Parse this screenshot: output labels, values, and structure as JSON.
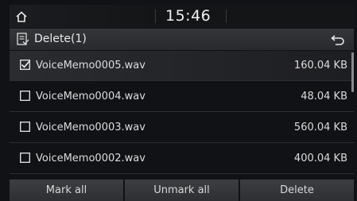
{
  "status": {
    "time": "15:46",
    "home_icon": "home-icon"
  },
  "header": {
    "title": "Delete(1)",
    "title_icon": "delete-list-icon",
    "back_icon": "back-arrow-icon"
  },
  "files": [
    {
      "name": "VoiceMemo0005.wav",
      "size": "160.04 KB",
      "checked": true
    },
    {
      "name": "VoiceMemo0004.wav",
      "size": "48.04 KB",
      "checked": false
    },
    {
      "name": "VoiceMemo0003.wav",
      "size": "560.04 KB",
      "checked": false
    },
    {
      "name": "VoiceMemo0002.wav",
      "size": "400.04 KB",
      "checked": false
    }
  ],
  "buttons": {
    "mark_all": "Mark all",
    "unmark_all": "Unmark all",
    "delete": "Delete"
  }
}
